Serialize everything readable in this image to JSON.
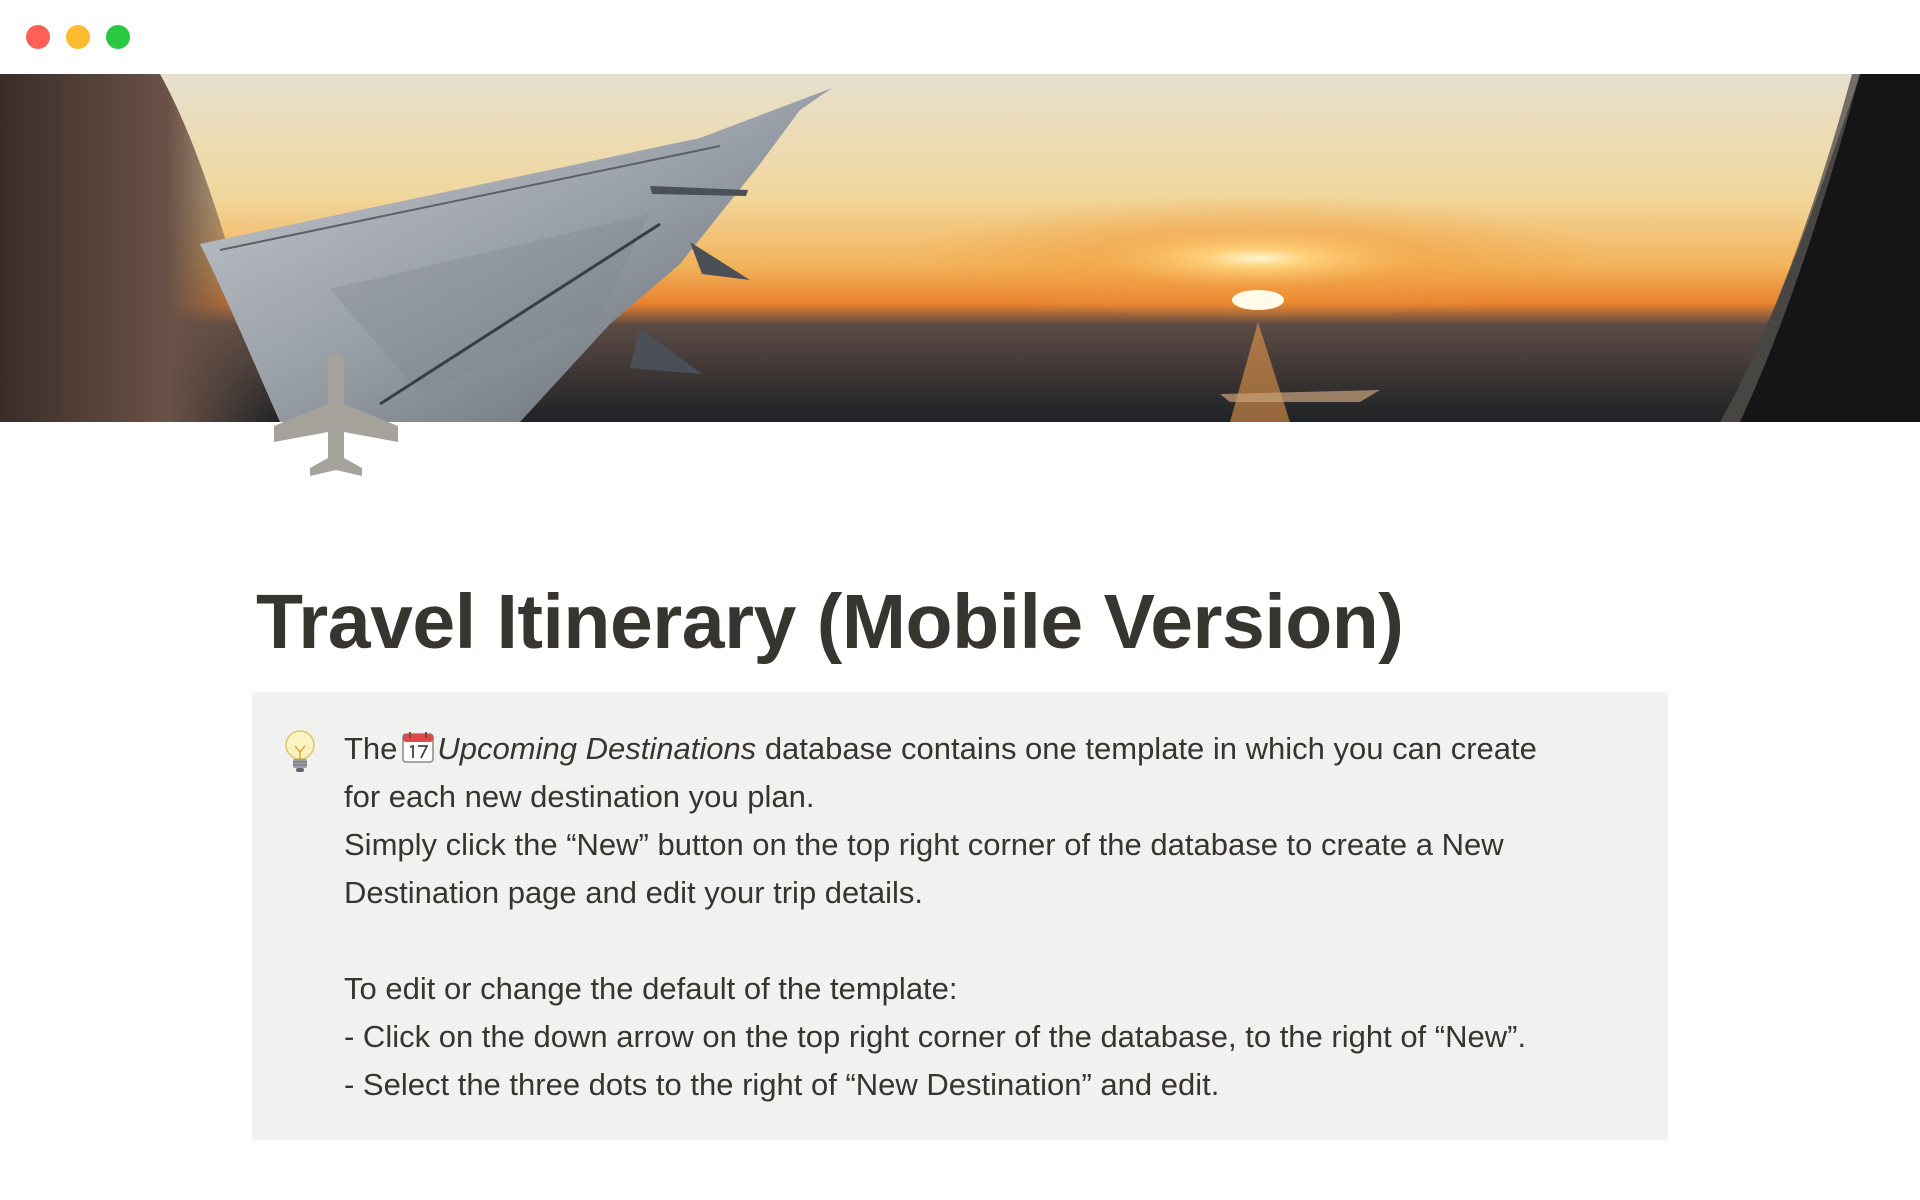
{
  "window": {
    "controls": {
      "close": "close",
      "minimize": "minimize",
      "zoom": "zoom"
    }
  },
  "cover": {
    "image": "airplane-wing-sunset-photo"
  },
  "page": {
    "icon": "airplane-icon",
    "title": "Travel Itinerary (Mobile Version)"
  },
  "callout": {
    "icon": "lightbulb-icon",
    "line1_prefix": "The",
    "database_icon": "calendar-icon",
    "database_name": "Upcoming Destinations",
    "line1_suffix": "database contains one template in which you can create",
    "line2": "for each new destination you plan.",
    "line3": "Simply click the “New” button on the top right corner of the database to create a New",
    "line4": "Destination page and edit your trip details.",
    "line5": "To edit or change the default of the template:",
    "line6": "- Click on the down arrow on the top right corner of the database, to the right of “New”.",
    "line7": "- Select the three dots to the right of “New Destination” and edit."
  },
  "colors": {
    "text": "#37352f",
    "callout_bg": "#f1f1ef",
    "icon_gray": "#a5a29c",
    "close": "#fe5f57",
    "minimize": "#febc2e",
    "zoom": "#28c840"
  }
}
